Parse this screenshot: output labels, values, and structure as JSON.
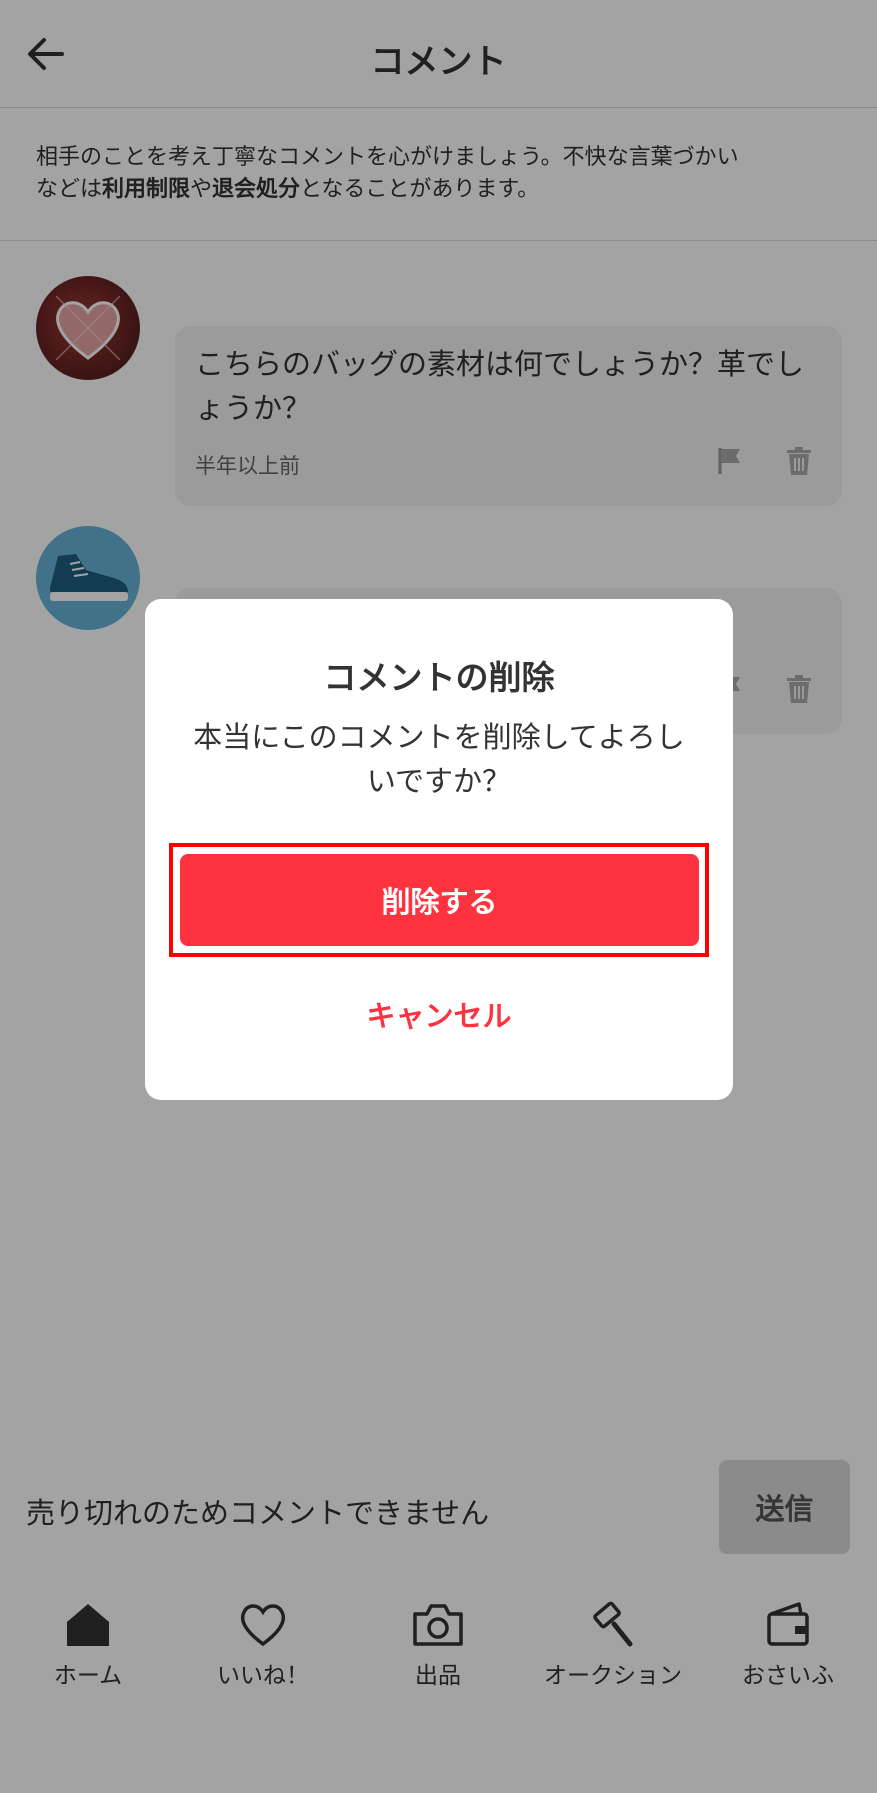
{
  "header": {
    "title": "コメント"
  },
  "notice": {
    "line1": "相手のことを考え丁寧なコメントを心がけましょう。不快な言葉づかい",
    "line2_prefix": "などは",
    "bold1": "利用制限",
    "mid": "や",
    "bold2": "退会処分",
    "line2_suffix": "となることがあります。"
  },
  "comments": [
    {
      "text": "こちらのバッグの素材は何でしょうか？革でしょうか？",
      "time": "半年以上前"
    }
  ],
  "comment_bar": {
    "disabled_text": "売り切れのためコメントできません",
    "send_label": "送信"
  },
  "tabs": [
    {
      "label": "ホーム",
      "icon": "home-icon"
    },
    {
      "label": "いいね！",
      "icon": "heart-icon"
    },
    {
      "label": "出品",
      "icon": "camera-icon"
    },
    {
      "label": "オークション",
      "icon": "gavel-icon"
    },
    {
      "label": "おさいふ",
      "icon": "wallet-icon"
    }
  ],
  "dialog": {
    "title": "コメントの削除",
    "message": "本当にこのコメントを削除してよろしいですか？",
    "confirm_label": "削除する",
    "cancel_label": "キャンセル"
  },
  "colors": {
    "accent": "#ff333f",
    "highlight": "#ff0000",
    "overlay": "rgba(0,0,0,0.36)"
  }
}
